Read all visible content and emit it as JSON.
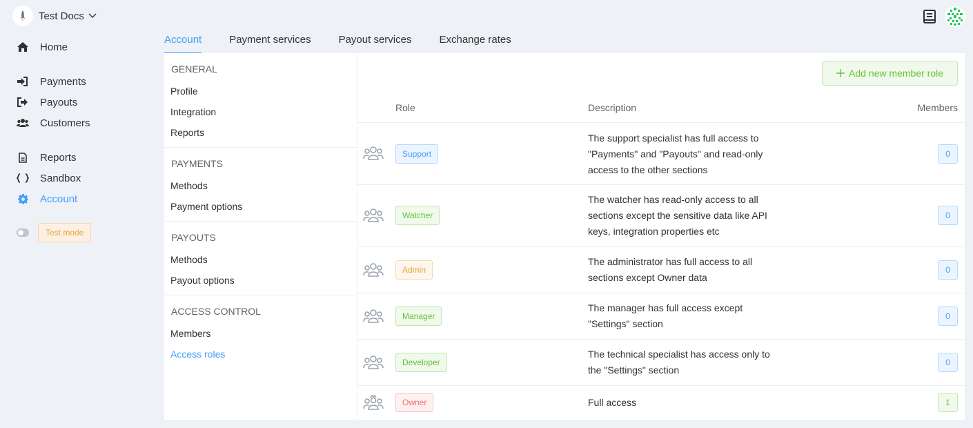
{
  "org": {
    "name": "Test Docs"
  },
  "nav": {
    "home": "Home",
    "payments": "Payments",
    "payouts": "Payouts",
    "customers": "Customers",
    "reports": "Reports",
    "sandbox": "Sandbox",
    "account": "Account",
    "test_mode": "Test mode"
  },
  "tabs": [
    "Account",
    "Payment services",
    "Payout services",
    "Exchange rates"
  ],
  "submenu": {
    "general": {
      "title": "GENERAL",
      "items": [
        "Profile",
        "Integration",
        "Reports"
      ]
    },
    "payments": {
      "title": "PAYMENTS",
      "items": [
        "Methods",
        "Payment options"
      ]
    },
    "payouts": {
      "title": "PAYOUTS",
      "items": [
        "Methods",
        "Payout options"
      ]
    },
    "access": {
      "title": "ACCESS CONTROL",
      "items": [
        "Members",
        "Access roles"
      ]
    }
  },
  "add_button": "Add new member role",
  "table": {
    "headers": {
      "role": "Role",
      "description": "Description",
      "members": "Members"
    },
    "rows": [
      {
        "role": "Support",
        "description": "The support specialist has full access to \"Payments\" and \"Payouts\" and read-only access to the other sections",
        "members": "0"
      },
      {
        "role": "Watcher",
        "description": "The watcher has read-only access to all sections except the sensitive data like API keys, integration properties etc",
        "members": "0"
      },
      {
        "role": "Admin",
        "description": "The administrator has full access to all sections except Owner data",
        "members": "0"
      },
      {
        "role": "Manager",
        "description": "The manager has full access except \"Settings\" section",
        "members": "0"
      },
      {
        "role": "Developer",
        "description": "The technical specialist has access only to the \"Settings\" section",
        "members": "0"
      },
      {
        "role": "Owner",
        "description": "Full access",
        "members": "1"
      }
    ]
  },
  "colors": {
    "accent": "#409eff",
    "success": "#67c23a",
    "warning": "#e6a23c",
    "danger": "#f56c6c"
  }
}
